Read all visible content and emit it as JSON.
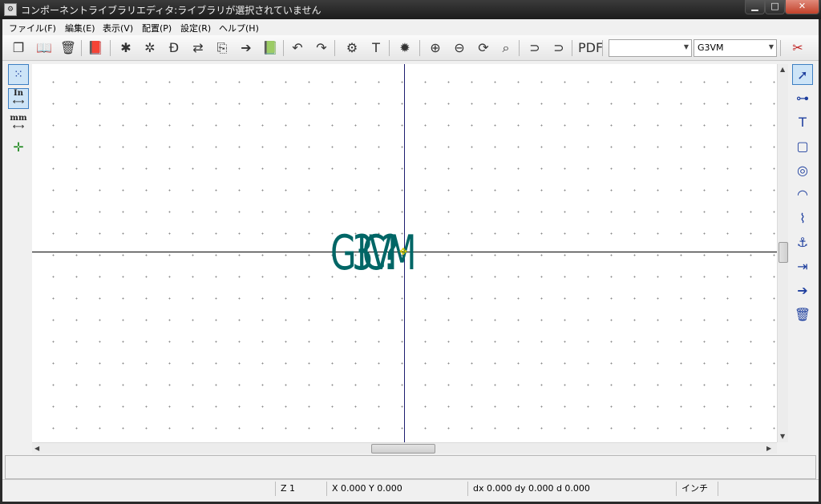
{
  "window": {
    "title": "コンポーネントライブラリエディタ:ライブラリが選択されていません",
    "controls": {
      "minimize": "▁",
      "maximize": "□",
      "close": "✕"
    }
  },
  "menubar": {
    "items": [
      {
        "label": "ファイル(F)"
      },
      {
        "label": "編集(E)"
      },
      {
        "label": "表示(V)"
      },
      {
        "label": "配置(P)"
      },
      {
        "label": "設定(R)"
      },
      {
        "label": "ヘルプ(H)"
      }
    ]
  },
  "toolbar": {
    "icons": [
      "select-library-icon",
      "open-library-icon",
      "delete-library-icon",
      "open-viewer-icon",
      "new-component-icon",
      "load-component-icon",
      "export-component-icon",
      "import-component-icon",
      "save-component-icon",
      "create-component-icon",
      "save-library-icon",
      "undo-icon",
      "redo-icon",
      "component-properties-icon",
      "text-icon",
      "check-pins-icon",
      "zoom-in-icon",
      "zoom-out-icon",
      "redraw-icon",
      "zoom-fit-icon",
      "convert-demorgan-icon",
      "show-demorgan-icon",
      "pdf-doc-icon",
      "pin-table-icon"
    ],
    "part_select": {
      "value": ""
    },
    "alias_select": {
      "value": "G3VM"
    }
  },
  "left_toolbar": {
    "items": [
      {
        "icon": "grid-icon",
        "label": "",
        "active": true
      },
      {
        "icon": "inch-units-icon",
        "label": "In",
        "active": true
      },
      {
        "icon": "mm-units-icon",
        "label": "mm",
        "active": false
      },
      {
        "icon": "cursor-shape-icon",
        "label": "",
        "active": false
      }
    ]
  },
  "canvas": {
    "reference_text": "G3VM",
    "value_text": "IC?",
    "colors": {
      "text": "#006666",
      "axis_h": "#000000",
      "axis_v": "#1c1c6f",
      "background": "#ffffff"
    }
  },
  "right_toolbar": {
    "items": [
      "select-tool-icon",
      "add-pin-icon",
      "add-text-icon",
      "add-rectangle-icon",
      "add-circle-icon",
      "add-arc-icon",
      "add-polyline-icon",
      "anchor-icon",
      "import-icon",
      "export-icon",
      "delete-icon"
    ]
  },
  "status": {
    "zoom": "Z 1",
    "coords": "X 0.000  Y 0.000",
    "delta": "dx 0.000  dy 0.000  d 0.000",
    "units": "インチ"
  }
}
